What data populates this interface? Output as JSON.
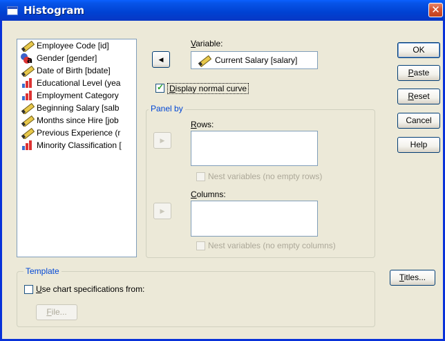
{
  "window": {
    "title": "Histogram",
    "close_glyph": "✕"
  },
  "variables": [
    {
      "label": "Employee Code [id]",
      "icon": "scale-ruler-icon"
    },
    {
      "label": "Gender [gender]",
      "icon": "nominal-string-icon"
    },
    {
      "label": "Date of Birth [bdate]",
      "icon": "date-ruler-icon"
    },
    {
      "label": "Educational Level (yea",
      "icon": "ordinal-bars-icon"
    },
    {
      "label": "Employment Category",
      "icon": "ordinal-bars-icon"
    },
    {
      "label": "Beginning Salary [salb",
      "icon": "scale-ruler-icon"
    },
    {
      "label": "Months since Hire [job",
      "icon": "scale-ruler-icon"
    },
    {
      "label": "Previous Experience (r",
      "icon": "scale-ruler-icon"
    },
    {
      "label": "Minority Classification [",
      "icon": "ordinal-bars-icon"
    }
  ],
  "variable_section": {
    "label_mn": "V",
    "label_rest": "ariable:",
    "value": "Current Salary [salary]",
    "move_glyph": "◀"
  },
  "normal_curve": {
    "label_mn": "D",
    "label_rest": "isplay normal curve",
    "checked": true
  },
  "panel_by": {
    "legend": "Panel by",
    "rows_label_mn": "R",
    "rows_label_rest": "ows:",
    "rows_nest": "Nest variables (no empty rows)",
    "columns_label_mn": "C",
    "columns_label_rest": "olumns:",
    "columns_nest": "Nest variables (no empty columns)",
    "move_glyph": "▶"
  },
  "template": {
    "legend": "Template",
    "use_label_mn": "U",
    "use_label_rest": "se chart specifications from:",
    "file_mn": "F",
    "file_rest": "ile..."
  },
  "buttons": {
    "ok": "OK",
    "paste_mn": "P",
    "paste_rest": "aste",
    "reset_mn": "R",
    "reset_rest": "eset",
    "cancel": "Cancel",
    "help": "Help",
    "titles_mn": "T",
    "titles_rest": "itles..."
  }
}
